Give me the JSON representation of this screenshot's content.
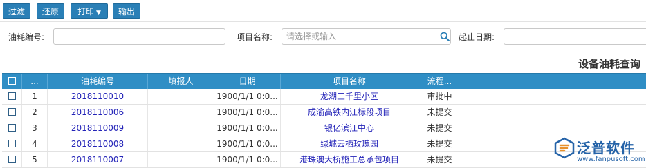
{
  "toolbar": {
    "filter_label": "过滤",
    "reset_label": "还原",
    "print_label": "打印",
    "export_label": "输出"
  },
  "filters": {
    "code_label": "油耗编号:",
    "code_value": "",
    "project_label": "项目名称:",
    "project_placeholder": "请选择或输入",
    "date_label": "起止日期:",
    "date_value": ""
  },
  "grid": {
    "title": "设备油耗查询",
    "columns": [
      "...",
      "油耗编号",
      "填报人",
      "日期",
      "项目名称",
      "流程..."
    ],
    "rows": [
      {
        "num": "1",
        "code": "2018110010",
        "reporter": "",
        "date": "1900/1/1 0:0...",
        "project": "龙湖三千里小区",
        "status": "审批中"
      },
      {
        "num": "2",
        "code": "2018110006",
        "reporter": "",
        "date": "1900/1/1 0:0...",
        "project": "成渝高铁内江标段项目",
        "status": "未提交"
      },
      {
        "num": "3",
        "code": "2018110009",
        "reporter": "",
        "date": "1900/1/1 0:0...",
        "project": "银亿滨江中心",
        "status": "未提交"
      },
      {
        "num": "4",
        "code": "2018110008",
        "reporter": "",
        "date": "1900/1/1 0:0...",
        "project": "绿城云栖玫瑰园",
        "status": "未提交"
      },
      {
        "num": "5",
        "code": "2018110007",
        "reporter": "",
        "date": "1900/1/1 0:0...",
        "project": "港珠澳大桥施工总承包项目",
        "status": "未提交"
      }
    ]
  },
  "logo": {
    "name": "泛普软件",
    "url": "www.fanpusoft.com"
  },
  "colors": {
    "button": "#2a7fb6",
    "header": "#2f8ec5",
    "link": "#2323b8",
    "logo": "#2563a8"
  }
}
